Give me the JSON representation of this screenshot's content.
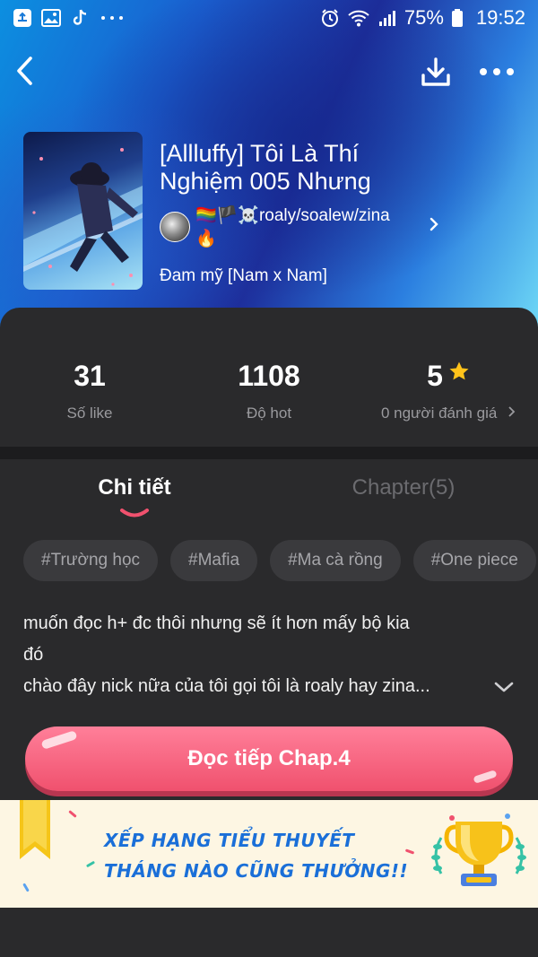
{
  "status_bar": {
    "icons_left": [
      "cloud-upload-icon",
      "gallery-icon",
      "tiktok-icon",
      "more-dots-icon"
    ],
    "icons_right": [
      "alarm-icon",
      "wifi-icon",
      "signal-icon",
      "battery-icon"
    ],
    "battery": "75%",
    "time": "19:52"
  },
  "header": {
    "title": "[Allluffy] Tôi Là Thí Nghiệm 005 Nhưng",
    "author": "🏳️‍🌈🏴☠️roaly/soalew/zina🔥",
    "genre": "Đam mỹ [Nam x Nam]"
  },
  "stats": [
    {
      "value": "31",
      "label": "Số like"
    },
    {
      "value": "1108",
      "label": "Độ hot"
    },
    {
      "value": "5",
      "label": "0 người đánh giá"
    }
  ],
  "tabs": {
    "details": "Chi tiết",
    "chapters": "Chapter(5)"
  },
  "tags": [
    "#Trường học",
    "#Mafia",
    "#Ma cà rồng",
    "#One piece"
  ],
  "description": {
    "line1": "muốn đọc h+ đc thôi nhưng sẽ ít hơn mấy bộ kia",
    "line2": "đó",
    "line3": "chào đây nick nữa của tôi gọi tôi là roaly hay zina..."
  },
  "read_button": "Đọc tiếp Chap.4",
  "banner": {
    "line1": "XẾP HẠNG TIỂU THUYẾT",
    "line2": "THÁNG NÀO CŨNG THƯỞNG!!"
  },
  "colors": {
    "accent": "#f0516e",
    "banner_text": "#1a6fd8",
    "star": "#ffc21a"
  }
}
